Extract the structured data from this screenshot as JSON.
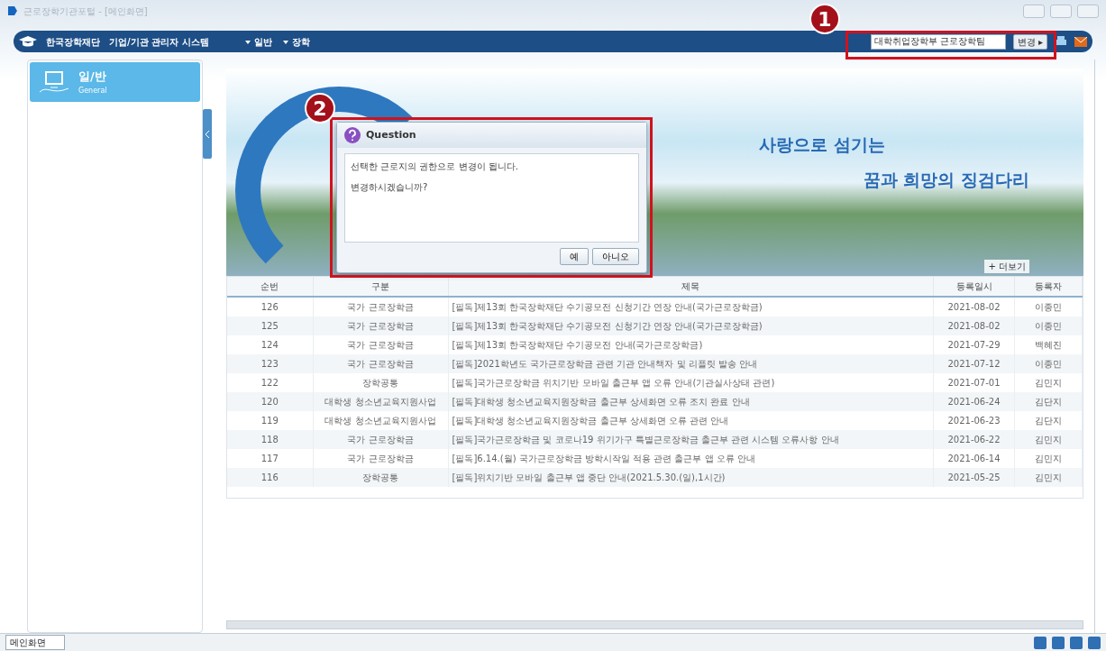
{
  "window": {
    "title": "근로장학기관포털 - [메인화면]"
  },
  "navbar": {
    "brand": "한국장학재단",
    "system_title": "기업/기관 관리자 시스템",
    "menus": [
      {
        "label": "일반"
      },
      {
        "label": "장학"
      }
    ],
    "org_field": {
      "value": "대학취업장학부 근로장학팀"
    },
    "change_button": "변경 ▸"
  },
  "sidebar": {
    "items": [
      {
        "label": "일/반",
        "sublabel": "General",
        "selected": true
      }
    ]
  },
  "banner": {
    "line_1": "사랑으로 섬기는",
    "line_2": "꿈과 희망의 **징검다리**"
  },
  "more_link": "+ 더보기",
  "table": {
    "columns": [
      "순번",
      "구분",
      "제목",
      "등록일시",
      "등록자"
    ],
    "rows": [
      [
        "126",
        "국가 근로장학금",
        "[필독]제13회 한국장학재단 수기공모전 신청기간 연장 안내(국가근로장학금)",
        "2021-08-02",
        "이종민"
      ],
      [
        "125",
        "국가 근로장학금",
        "[필독]제13회 한국장학재단 수기공모전 신청기간 연장 안내(국가근로장학금)",
        "2021-08-02",
        "이종민"
      ],
      [
        "124",
        "국가 근로장학금",
        "[필독]제13회 한국장학재단 수기공모전 안내(국가근로장학금)",
        "2021-07-29",
        "백혜진"
      ],
      [
        "123",
        "국가 근로장학금",
        "[필독]2021학년도 국가근로장학금 관련 기관 안내책자 및 리플릿 발송 안내",
        "2021-07-12",
        "이종민"
      ],
      [
        "122",
        "장학공통",
        "[필독]국가근로장학금 위치기반 모바일 출근부 앱 오류 안내(기관실사상태 관련)",
        "2021-07-01",
        "김민지"
      ],
      [
        "120",
        "대학생 청소년교육지원사업",
        "[필독]대학생 청소년교육지원장학금 출근부 상세화면 오류 조치 완료 안내",
        "2021-06-24",
        "김단지"
      ],
      [
        "119",
        "대학생 청소년교육지원사업",
        "[필독]대학생 청소년교육지원장학금 출근부 상세화면 오류 관련 안내",
        "2021-06-23",
        "김단지"
      ],
      [
        "118",
        "국가 근로장학금",
        "[필독]국가근로장학금 및 코로나19 위기가구 특별근로장학금 출근부 관련 시스템 오류사항 안내",
        "2021-06-22",
        "김민지"
      ],
      [
        "117",
        "국가 근로장학금",
        "[필독]6.14.(월) 국가근로장학금 방학시작일 적용 관련 출근부 앱 오류 안내",
        "2021-06-14",
        "김민지"
      ],
      [
        "116",
        "장학공통",
        "[필독]위치기반 모바일 출근부 앱 중단 안내(2021.5.30.(일),1시간)",
        "2021-05-25",
        "김민지"
      ]
    ]
  },
  "dialog": {
    "title": "Question",
    "message_lines": [
      "선택한 근로지의 권한으로 변경이 됩니다.",
      "변경하시겠습니까?"
    ],
    "buttons": [
      "예",
      "아니오"
    ]
  },
  "annotations": [
    {
      "label": "1"
    },
    {
      "label": "2"
    }
  ],
  "status_bar": {
    "tabs": [
      {
        "label": "메인화면",
        "selected": true
      }
    ]
  }
}
